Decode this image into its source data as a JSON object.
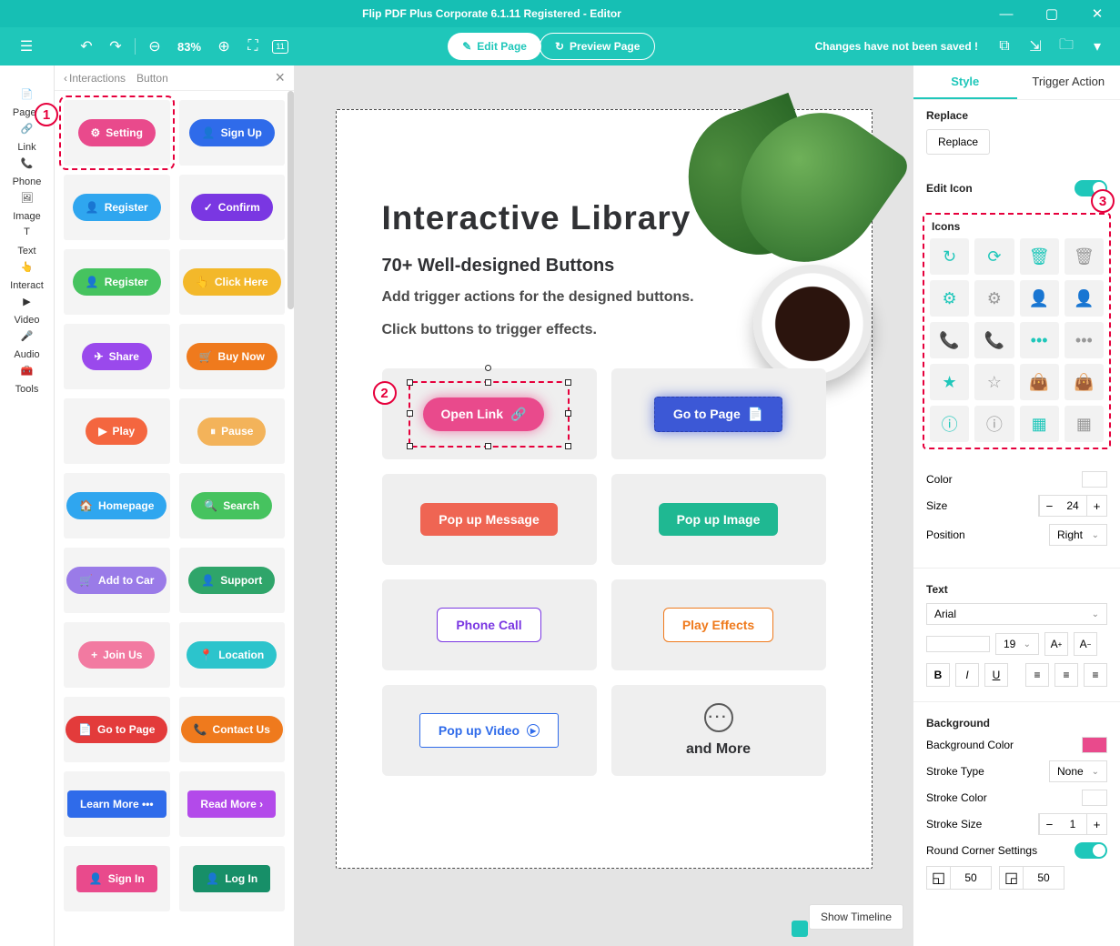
{
  "title": "Flip PDF Plus Corporate 6.1.11 Registered - Editor",
  "toolbar": {
    "zoom": "83%",
    "edit_page": "Edit Page",
    "preview_page": "Preview Page",
    "save_msg": "Changes have not been saved !"
  },
  "left_rail": [
    {
      "label": "Pages",
      "icon": "file-icon"
    },
    {
      "label": "Link",
      "icon": "link-icon"
    },
    {
      "label": "Phone",
      "icon": "phone-icon"
    },
    {
      "label": "Image",
      "icon": "image-icon"
    },
    {
      "label": "Text",
      "icon": "text-icon"
    },
    {
      "label": "Interact",
      "icon": "pointer-icon"
    },
    {
      "label": "Video",
      "icon": "video-icon"
    },
    {
      "label": "Audio",
      "icon": "audio-icon"
    },
    {
      "label": "Tools",
      "icon": "tools-icon"
    }
  ],
  "panel": {
    "back": "Interactions",
    "crumb": "Button",
    "buttons": [
      {
        "label": "Setting",
        "bg": "#e94a8c",
        "icon": "⚙"
      },
      {
        "label": "Sign Up",
        "bg": "#2f6bea",
        "icon": "👤"
      },
      {
        "label": "Register",
        "bg": "#2fa6ef",
        "icon": "👤"
      },
      {
        "label": "Confirm",
        "bg": "#7a37e2",
        "icon": "✓"
      },
      {
        "label": "Register",
        "bg": "#46c35f",
        "icon": "👤"
      },
      {
        "label": "Click Here",
        "bg": "#f3b82a",
        "icon": "👆"
      },
      {
        "label": "Share",
        "bg": "#9a49ec",
        "icon": "✈"
      },
      {
        "label": "Buy Now",
        "bg": "#ef7a1d",
        "icon": "🛒"
      },
      {
        "label": "Play",
        "bg": "#f4663f",
        "icon": "▶"
      },
      {
        "label": "Pause",
        "bg": "#f3b35a",
        "icon": "⏸"
      },
      {
        "label": "Homepage",
        "bg": "#2fa6ef",
        "icon": "🏠"
      },
      {
        "label": "Search",
        "bg": "#46c35f",
        "icon": "🔍"
      },
      {
        "label": "Add to Car",
        "bg": "#9a7be8",
        "icon": "🛒"
      },
      {
        "label": "Support",
        "bg": "#2fa56a",
        "icon": "👤"
      },
      {
        "label": "Join Us",
        "bg": "#f27aa1",
        "icon": "+"
      },
      {
        "label": "Location",
        "bg": "#2cc4cc",
        "icon": "📍"
      },
      {
        "label": "Go to Page",
        "bg": "#e33b3b",
        "icon": "📄"
      },
      {
        "label": "Contact Us",
        "bg": "#ef7a1d",
        "icon": "📞"
      },
      {
        "label": "Learn More •••",
        "bg": "#2f6bea",
        "icon": ""
      },
      {
        "label": "Read More  ›",
        "bg": "#b34aea",
        "icon": ""
      },
      {
        "label": "Sign In",
        "bg": "#e94a8c",
        "icon": "👤"
      },
      {
        "label": "Log In",
        "bg": "#178f68",
        "icon": "👤"
      }
    ]
  },
  "canvas": {
    "heading": "Interactive Library",
    "sub1": "70+ Well-designed Buttons",
    "sub2": "Add trigger actions for the designed buttons.",
    "sub3": "Click buttons to trigger effects.",
    "cards": {
      "open_link": "Open Link",
      "go_to_page": "Go to Page",
      "pop_msg": "Pop up Message",
      "pop_img": "Pop up Image",
      "phone_call": "Phone Call",
      "play_effects": "Play Effects",
      "pop_video": "Pop up Video",
      "and_more": "and More"
    },
    "timeline": "Show Timeline"
  },
  "right": {
    "tab_style": "Style",
    "tab_trigger": "Trigger Action",
    "replace_hdr": "Replace",
    "replace_btn": "Replace",
    "edit_icon": "Edit Icon",
    "icons_hdr": "Icons",
    "icons": [
      {
        "name": "refresh-icon",
        "f": true
      },
      {
        "name": "refresh-alt-icon",
        "f": true
      },
      {
        "name": "trash-icon",
        "f": true
      },
      {
        "name": "trash-outline-icon",
        "f": false
      },
      {
        "name": "gear-icon",
        "f": true
      },
      {
        "name": "gear-outline-icon",
        "f": false
      },
      {
        "name": "person-icon",
        "f": true
      },
      {
        "name": "person-outline-icon",
        "f": false
      },
      {
        "name": "phone-icon",
        "f": true
      },
      {
        "name": "call-icon",
        "f": false
      },
      {
        "name": "dots-icon",
        "f": true
      },
      {
        "name": "dots-outline-icon",
        "f": false
      },
      {
        "name": "star-icon",
        "f": true
      },
      {
        "name": "star-outline-icon",
        "f": false
      },
      {
        "name": "bag-icon",
        "f": true
      },
      {
        "name": "bag-outline-icon",
        "f": false
      },
      {
        "name": "info-icon",
        "f": true
      },
      {
        "name": "info-outline-icon",
        "f": false
      },
      {
        "name": "grid-icon",
        "f": true
      },
      {
        "name": "grid-outline-icon",
        "f": false
      }
    ],
    "color_lbl": "Color",
    "color_val": "#ffffff",
    "size_lbl": "Size",
    "size_val": "24",
    "position_lbl": "Position",
    "position_val": "Right",
    "text_lbl": "Text",
    "font_val": "Arial",
    "fontsize_val": "19",
    "bg_lbl": "Background",
    "bgcolor_lbl": "Background Color",
    "bgcolor_val": "#e94a8c",
    "stroketype_lbl": "Stroke Type",
    "stroketype_val": "None",
    "strokecolor_lbl": "Stroke Color",
    "strokecolor_val": "#ffffff",
    "strokesize_lbl": "Stroke Size",
    "strokesize_val": "1",
    "round_lbl": "Round Corner Settings",
    "corner_a": "50",
    "corner_b": "50"
  },
  "annotations": {
    "a1": "1",
    "a2": "2",
    "a3": "3"
  }
}
